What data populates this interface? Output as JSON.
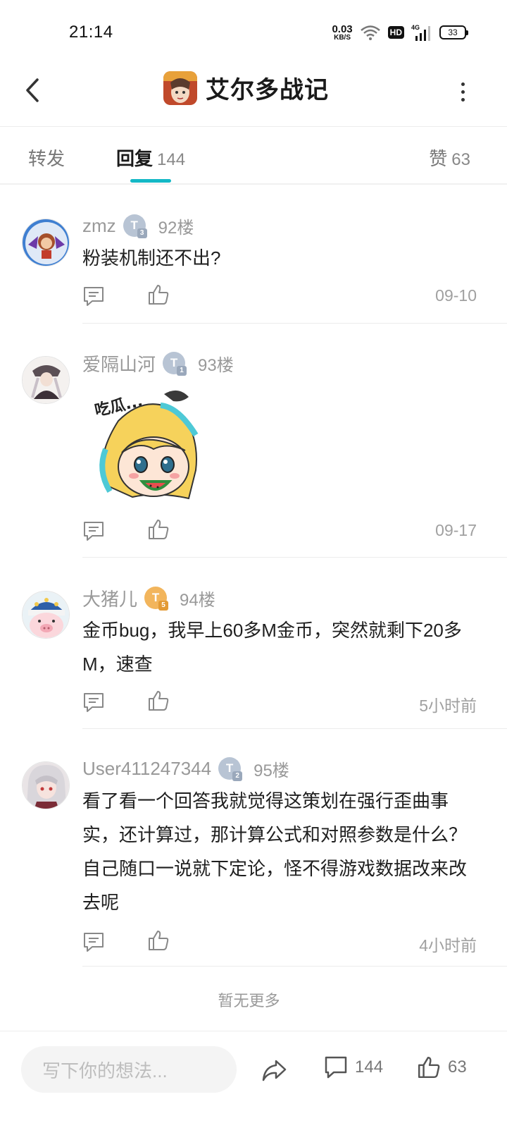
{
  "status": {
    "time": "21:14",
    "net_speed_value": "0.03",
    "net_speed_unit": "KB/S",
    "hd_label": "HD",
    "network_label": "4G",
    "battery": "33"
  },
  "header": {
    "title": "艾尔多战记",
    "icons": [
      "back-arrow-icon",
      "app-icon",
      "more-vertical-icon"
    ]
  },
  "tabs": [
    {
      "label": "转发",
      "count": ""
    },
    {
      "label": "回复",
      "count": "144"
    },
    {
      "label": "赞",
      "count": "63"
    }
  ],
  "comments": [
    {
      "name": "zmz",
      "level": "3",
      "badge_color": "#b8c4d4",
      "floor": "92楼",
      "text": "粉装机制还不出?",
      "time": "09-10"
    },
    {
      "name": "爱隔山河",
      "level": "1",
      "badge_color": "#b8c4d4",
      "floor": "93楼",
      "text": "",
      "sticker": "吃瓜...",
      "time": "09-17"
    },
    {
      "name": "大猪儿",
      "level": "5",
      "badge_color": "#f2b55c",
      "floor": "94楼",
      "text": "金币bug，我早上60多M金币，突然就剩下20多M，速查",
      "time": "5小时前"
    },
    {
      "name": "User411247344",
      "level": "2",
      "badge_color": "#b8c4d4",
      "floor": "95楼",
      "text": "看了看一个回答我就觉得这策划在强行歪曲事实，还计算过，那计算公式和对照参数是什么？自己随口一说就下定论，怪不得游戏数据改来改去呢",
      "time": "4小时前"
    }
  ],
  "badge_letter": "T",
  "footer_note": "暂无更多",
  "bottom_bar": {
    "input_placeholder": "写下你的想法...",
    "comment_count": "144",
    "like_count": "63"
  },
  "colors": {
    "accent": "#14b8c6",
    "muted_text": "#999999"
  }
}
